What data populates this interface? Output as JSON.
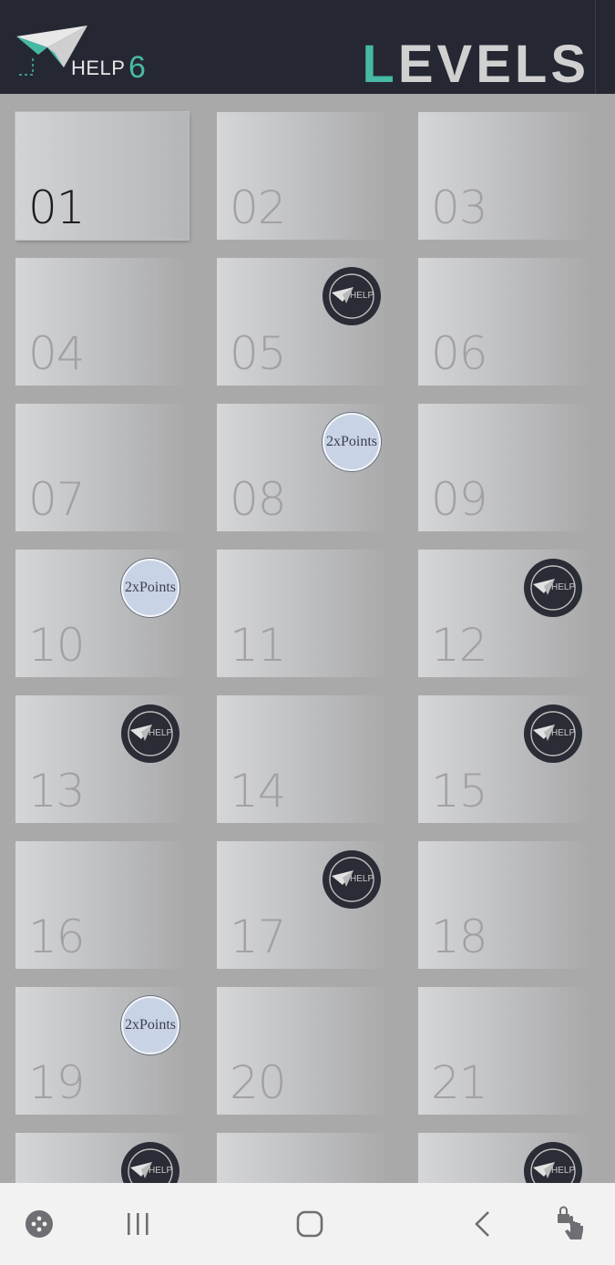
{
  "header": {
    "help_label": "HELP",
    "help_count": "6",
    "title_first": "L",
    "title_rest": "EVELS",
    "accent": "#47b9a4",
    "background": "#252833"
  },
  "levels": [
    {
      "num": "01",
      "badge": ""
    },
    {
      "num": "02",
      "badge": ""
    },
    {
      "num": "03",
      "badge": ""
    },
    {
      "num": "04",
      "badge": ""
    },
    {
      "num": "05",
      "badge": "help"
    },
    {
      "num": "06",
      "badge": ""
    },
    {
      "num": "07",
      "badge": ""
    },
    {
      "num": "08",
      "badge": "points"
    },
    {
      "num": "09",
      "badge": ""
    },
    {
      "num": "10",
      "badge": "points"
    },
    {
      "num": "11",
      "badge": ""
    },
    {
      "num": "12",
      "badge": "help"
    },
    {
      "num": "13",
      "badge": "help"
    },
    {
      "num": "14",
      "badge": ""
    },
    {
      "num": "15",
      "badge": "help"
    },
    {
      "num": "16",
      "badge": ""
    },
    {
      "num": "17",
      "badge": "help"
    },
    {
      "num": "18",
      "badge": ""
    },
    {
      "num": "19",
      "badge": "points"
    },
    {
      "num": "20",
      "badge": ""
    },
    {
      "num": "21",
      "badge": ""
    },
    {
      "num": "",
      "badge": "help"
    },
    {
      "num": "",
      "badge": ""
    },
    {
      "num": "",
      "badge": "help"
    }
  ],
  "badges": {
    "help_text": "HELP",
    "points_text": "2xPoints"
  },
  "navbar": {
    "icons": [
      "game-launcher-icon",
      "recent-apps-icon",
      "home-icon",
      "back-icon",
      "touch-lock-icon"
    ]
  }
}
